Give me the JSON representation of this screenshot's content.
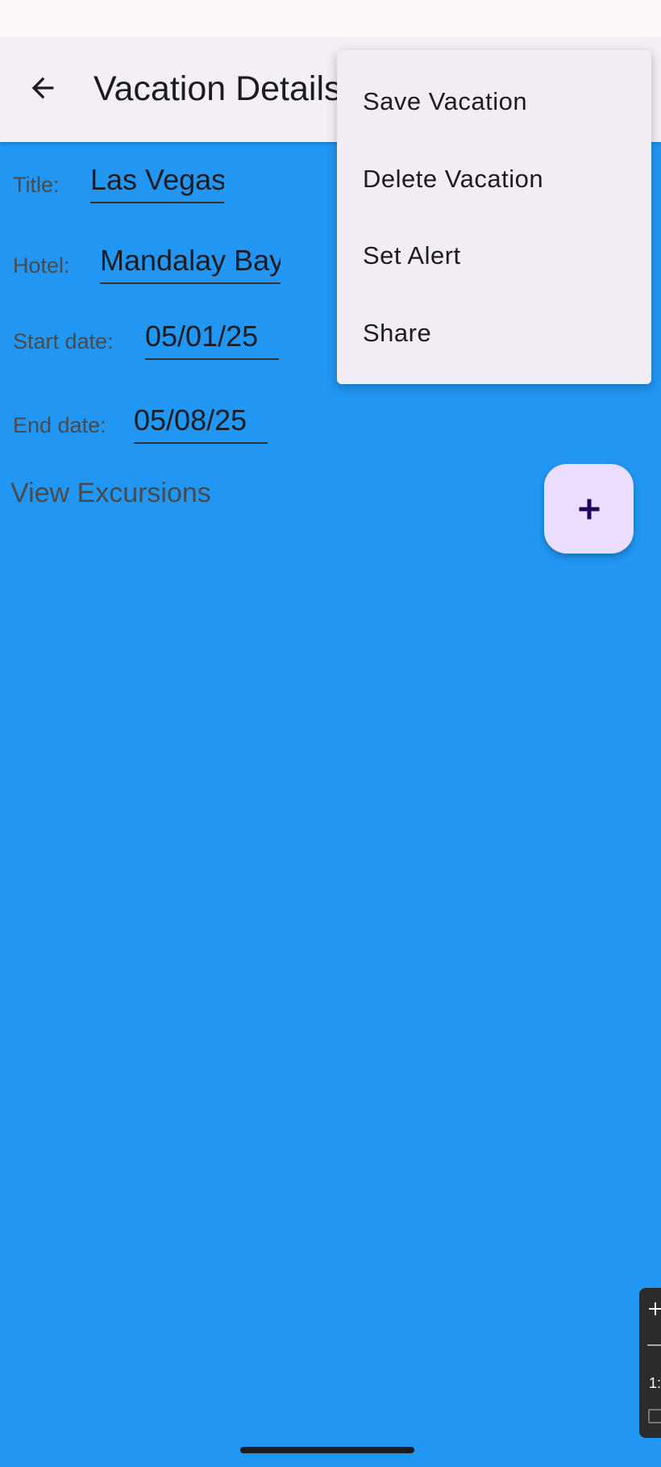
{
  "app_bar": {
    "title": "Vacation Details",
    "back_icon": "arrow-back-icon"
  },
  "form": {
    "title_label": "Title:",
    "title_value": "Las Vegas",
    "hotel_label": "Hotel:",
    "hotel_value": "Mandalay Bay",
    "start_label": "Start date:",
    "start_value": "05/01/25",
    "end_label": "End date:",
    "end_value": "05/08/25"
  },
  "view_excursions": "View Excursions",
  "fab": {
    "icon": "plus-icon",
    "color": "#eaddff"
  },
  "menu": {
    "items": [
      {
        "label": "Save Vacation"
      },
      {
        "label": "Delete Vacation"
      },
      {
        "label": "Set Alert"
      },
      {
        "label": "Share"
      }
    ]
  },
  "side_toolbar": {
    "text": "1:"
  },
  "colors": {
    "background": "#2196F3",
    "app_bar": "#f4eff4",
    "menu": "#f2ecf5"
  }
}
